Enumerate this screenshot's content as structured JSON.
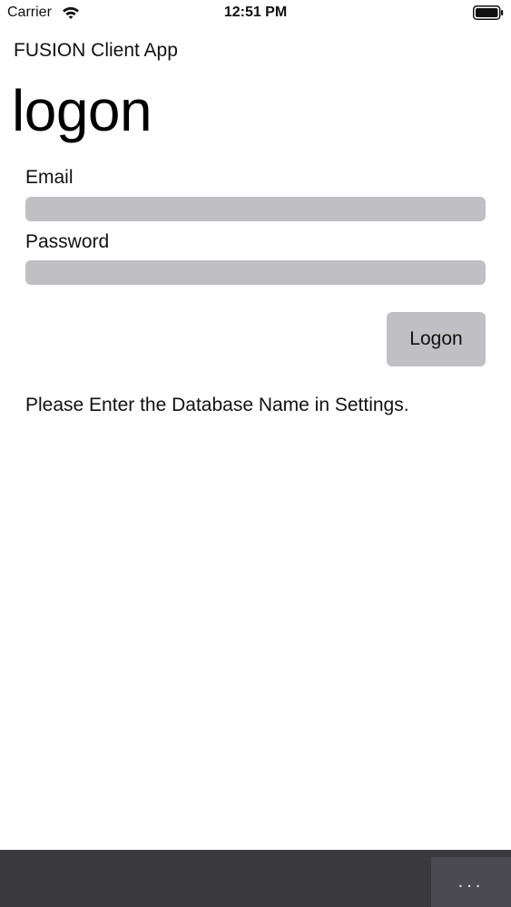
{
  "status_bar": {
    "carrier": "Carrier",
    "time": "12:51 PM"
  },
  "header": {
    "app_title": "FUSION Client App",
    "page_title": "logon"
  },
  "form": {
    "email_label": "Email",
    "email_value": "",
    "password_label": "Password",
    "password_value": "",
    "logon_label": "Logon"
  },
  "message": "Please Enter the Database Name in Settings.",
  "bottom_bar": {
    "more_label": "..."
  },
  "colors": {
    "field_background": "#c0bfc3",
    "bottom_bar": "#3a393e",
    "more_button": "#4b4a50"
  }
}
